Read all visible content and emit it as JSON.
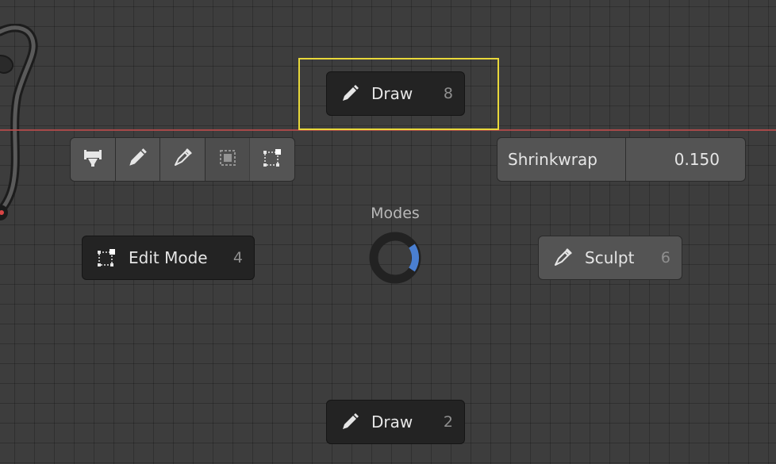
{
  "pie_menu": {
    "title": "Modes",
    "items": [
      {
        "id": "draw_top",
        "label": "Draw",
        "hotkey": "8",
        "icon": "pencil-icon"
      },
      {
        "id": "edit_mode",
        "label": "Edit Mode",
        "hotkey": "4",
        "icon": "edit-mode-icon"
      },
      {
        "id": "sculpt",
        "label": "Sculpt",
        "hotkey": "6",
        "icon": "sculpt-brush-icon"
      },
      {
        "id": "draw_bottom",
        "label": "Draw",
        "hotkey": "2",
        "icon": "pencil-icon"
      }
    ]
  },
  "toolbar": {
    "tools": [
      {
        "icon": "weight-paint-icon"
      },
      {
        "icon": "pencil-icon"
      },
      {
        "icon": "sculpt-brush-icon"
      },
      {
        "icon": "object-mode-icon",
        "disabled": true
      },
      {
        "icon": "edit-mode-icon"
      }
    ]
  },
  "shrinkwrap": {
    "label": "Shrinkwrap",
    "value": "0.150"
  },
  "colors": {
    "highlight": "#e8d83a",
    "x_axis": "#b24a4a",
    "ring_indicator": "#4a7fd1"
  }
}
